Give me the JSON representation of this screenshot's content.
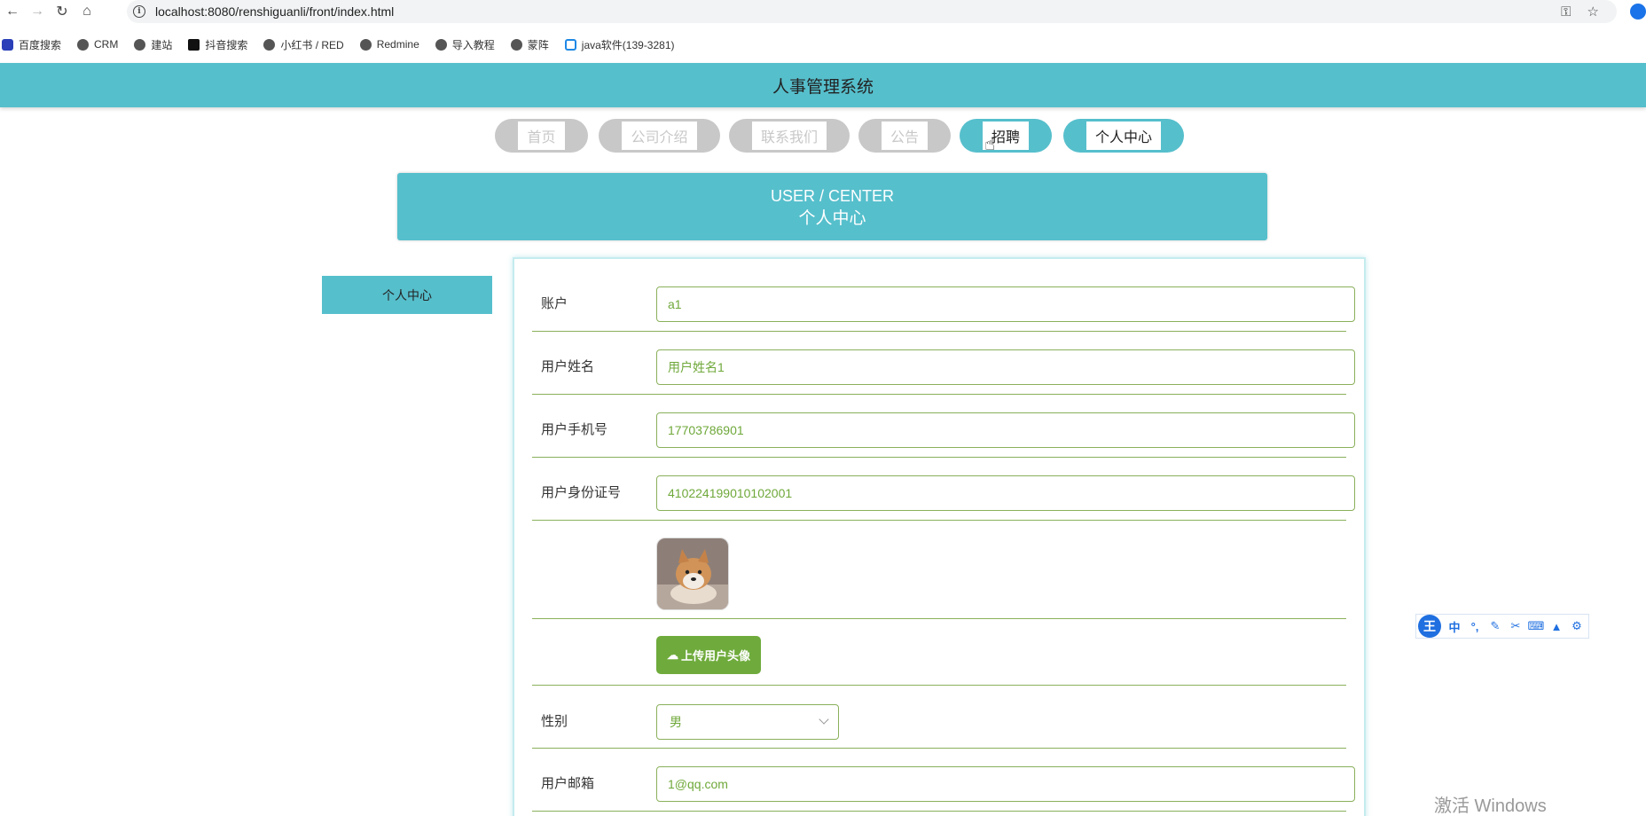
{
  "browser": {
    "url": "localhost:8080/renshiguanli/front/index.html",
    "bookmarks": [
      {
        "label": "百度搜索",
        "icon": "paw-icon"
      },
      {
        "label": "CRM",
        "icon": "globe-icon"
      },
      {
        "label": "建站",
        "icon": "globe-icon"
      },
      {
        "label": "抖音搜索",
        "icon": "tiktok-icon"
      },
      {
        "label": "小红书 / RED",
        "icon": "globe-icon"
      },
      {
        "label": "Redmine",
        "icon": "globe-icon"
      },
      {
        "label": "导入教程",
        "icon": "globe-icon"
      },
      {
        "label": "蒙阵",
        "icon": "globe-icon"
      },
      {
        "label": "java软件(139-3281)",
        "icon": "bilibili-icon"
      }
    ]
  },
  "site": {
    "title": "人事管理系统"
  },
  "nav": {
    "items": [
      {
        "label": "首页",
        "active": false
      },
      {
        "label": "公司介绍",
        "active": false
      },
      {
        "label": "联系我们",
        "active": false
      },
      {
        "label": "公告",
        "active": false
      },
      {
        "label": "招聘",
        "active": true
      },
      {
        "label": "个人中心",
        "active": true
      }
    ]
  },
  "banner": {
    "en": "USER / CENTER",
    "cn": "个人中心"
  },
  "sidebar": {
    "items": [
      {
        "label": "个人中心"
      }
    ]
  },
  "form": {
    "account": {
      "label": "账户",
      "value": "a1"
    },
    "name": {
      "label": "用户姓名",
      "value": "用户姓名1"
    },
    "phone": {
      "label": "用户手机号",
      "value": "17703786901"
    },
    "idcard": {
      "label": "用户身份证号",
      "value": "410224199010102001"
    },
    "upload": {
      "label": "上传用户头像"
    },
    "gender": {
      "label": "性别",
      "value": "男"
    },
    "email": {
      "label": "用户邮箱",
      "value": "1@qq.com"
    }
  },
  "ime": {
    "logo": "王",
    "mode": "中"
  },
  "os": {
    "watermark": "激活 Windows"
  },
  "colors": {
    "accent": "#56bfcc",
    "field_border": "#8ab05b",
    "field_text": "#6fa83a",
    "upload_button": "#6fab3c"
  }
}
